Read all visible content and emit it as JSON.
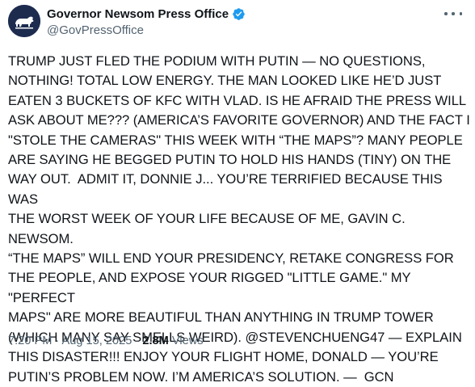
{
  "author": {
    "display_name": "Governor Newsom Press Office",
    "handle": "@GovPressOffice",
    "verified": true,
    "avatar_icon": "california-bear-icon",
    "avatar_bg": "#1d2b4f",
    "verified_color": "#1d9bf0"
  },
  "tweet": {
    "text": "TRUMP JUST FLED THE PODIUM WITH PUTIN — NO QUESTIONS,\nNOTHING! TOTAL LOW ENERGY. THE MAN LOOKED LIKE HE’D JUST\nEATEN 3 BUCKETS OF KFC WITH VLAD. IS HE AFRAID THE PRESS WILL\nASK ABOUT ME??? (AMERICA’S FAVORITE GOVERNOR) AND THE FACT I\n\"STOLE THE CAMERAS\" THIS WEEK WITH “THE MAPS”? MANY PEOPLE\nARE SAYING HE BEGGED PUTIN TO HOLD HIS HANDS (TINY) ON THE\nWAY OUT.  ADMIT IT, DONNIE J... YOU’RE TERRIFIED BECAUSE THIS WAS\nTHE WORST WEEK OF YOUR LIFE BECAUSE OF ME, GAVIN C. NEWSOM.\n“THE MAPS” WILL END YOUR PRESIDENCY, RETAKE CONGRESS FOR\nTHE PEOPLE, AND EXPOSE YOUR RIGGED \"LITTLE GAME.\" MY \"PERFECT\nMAPS\" ARE MORE BEAUTIFUL THAN ANYTHING IN TRUMP TOWER\n(WHICH MANY SAY SMELLS WEIRD). @STEVENCHUENG47 — EXPLAIN\nTHIS DISASTER!!! ENJOY YOUR FLIGHT HOME, DONALD — YOU’RE\nPUTIN’S PROBLEM NOW. I’M AMERICA’S SOLUTION. —  GCN"
  },
  "meta": {
    "time": "7:20 PM",
    "separator": " · ",
    "date": "Aug 15, 2025",
    "views_count": "2.8M",
    "views_label": " Views"
  }
}
